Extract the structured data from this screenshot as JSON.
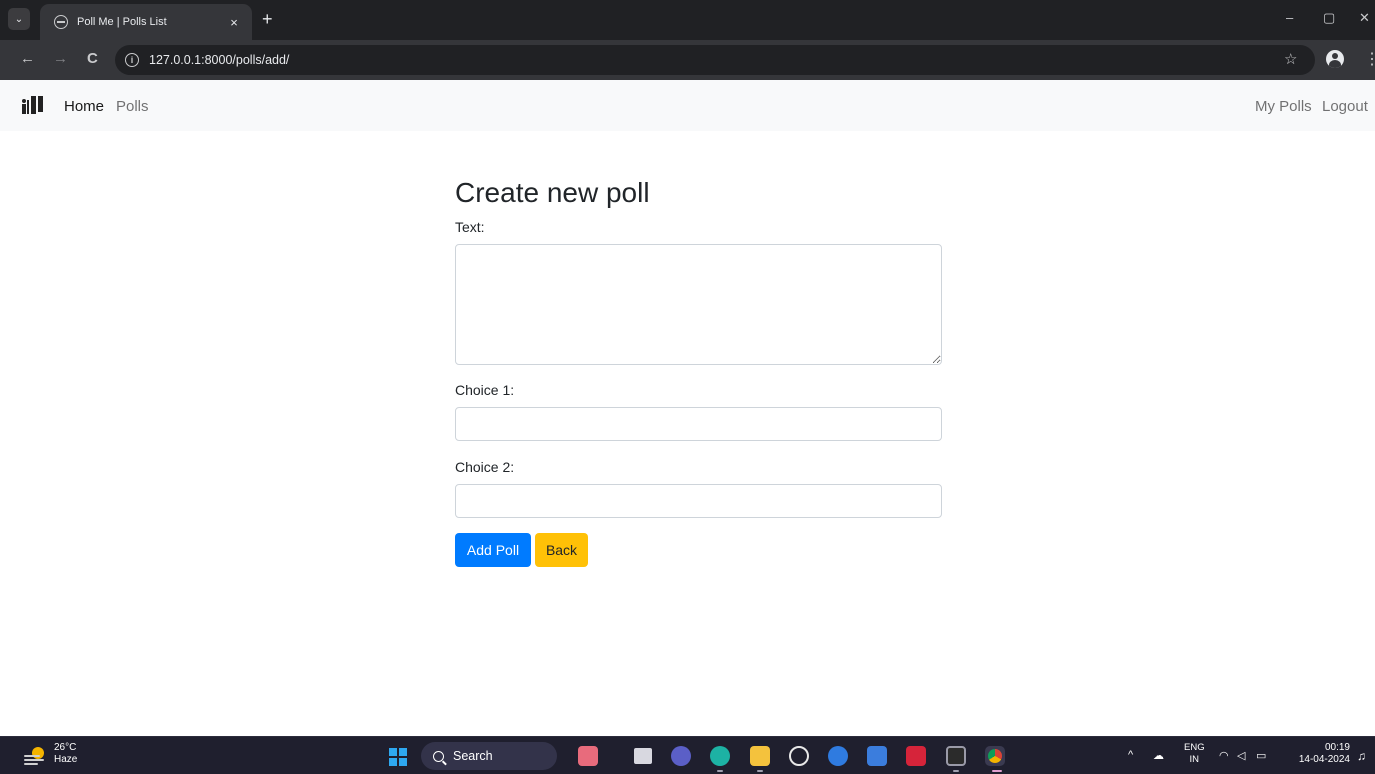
{
  "browser": {
    "tab_title": "Poll Me | Polls List",
    "tab_close": "×",
    "new_tab": "+",
    "url": "127.0.0.1:8000/polls/add/",
    "back": "←",
    "forward": "→",
    "reload": "C",
    "star": "☆",
    "menu": "⋮",
    "minimize": "–",
    "restore": "▢",
    "close": "✕",
    "tab_list": "⌄",
    "info": "i"
  },
  "navbar": {
    "brand_icon": "poll-brand-icon",
    "links": [
      "Home",
      "Polls"
    ],
    "right_links": [
      "My Polls",
      "Logout"
    ]
  },
  "form": {
    "title": "Create new poll",
    "text_label": "Text:",
    "text_value": "",
    "choice1_label": "Choice 1:",
    "choice1_value": "",
    "choice2_label": "Choice 2:",
    "choice2_value": "",
    "submit_label": "Add Poll",
    "back_label": "Back"
  },
  "colors": {
    "primary": "#007bff",
    "warning": "#ffc107",
    "navbar_bg": "#f8f9fa"
  },
  "taskbar": {
    "weather_temp": "26°C",
    "weather_desc": "Haze",
    "search_label": "Search",
    "lang_top": "ENG",
    "lang_bottom": "IN",
    "time": "00:19",
    "date": "14-04-2024",
    "tray_chevron": "^"
  }
}
